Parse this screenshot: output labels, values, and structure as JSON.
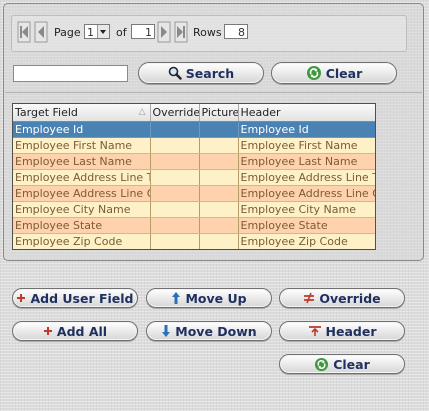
{
  "pager": {
    "page_label": "Page",
    "page_value": "1",
    "of_label": "of",
    "total_pages": "1",
    "rows_label": "Rows",
    "rows_value": "8"
  },
  "search": {
    "value": "",
    "placeholder": ""
  },
  "search_button": {
    "label": "Search",
    "icon": "magnifier-icon"
  },
  "clear_top_button": {
    "label": "Clear",
    "icon": "recycle-icon"
  },
  "grid": {
    "columns": [
      "Target Field",
      "Override",
      "Picture",
      "Header"
    ],
    "rows": [
      {
        "target": "Employee Id",
        "override": "",
        "picture": "",
        "header": "Employee Id"
      },
      {
        "target": "Employee First Name",
        "override": "",
        "picture": "",
        "header": "Employee First Name"
      },
      {
        "target": "Employee Last Name",
        "override": "",
        "picture": "",
        "header": "Employee Last Name"
      },
      {
        "target": "Employee Address Line Two",
        "override": "",
        "picture": "",
        "header": "Employee Address Line Two"
      },
      {
        "target": "Employee Address Line One",
        "override": "",
        "picture": "",
        "header": "Employee Address Line One"
      },
      {
        "target": "Employee City Name",
        "override": "",
        "picture": "",
        "header": "Employee City Name"
      },
      {
        "target": "Employee State",
        "override": "",
        "picture": "",
        "header": "Employee State"
      },
      {
        "target": "Employee Zip Code",
        "override": "",
        "picture": "",
        "header": "Employee Zip Code"
      }
    ],
    "selected_index": 0
  },
  "buttons": {
    "add_user_field": "Add User Field",
    "move_up": "Move Up",
    "override": "Override",
    "add_all": "Add All",
    "move_down": "Move Down",
    "header": "Header",
    "clear": "Clear"
  },
  "colors": {
    "selected_row": "#4a82b4",
    "row_light": "#fff1c7",
    "row_peach": "#ffd2ae",
    "button_text": "#1f2f5f"
  }
}
